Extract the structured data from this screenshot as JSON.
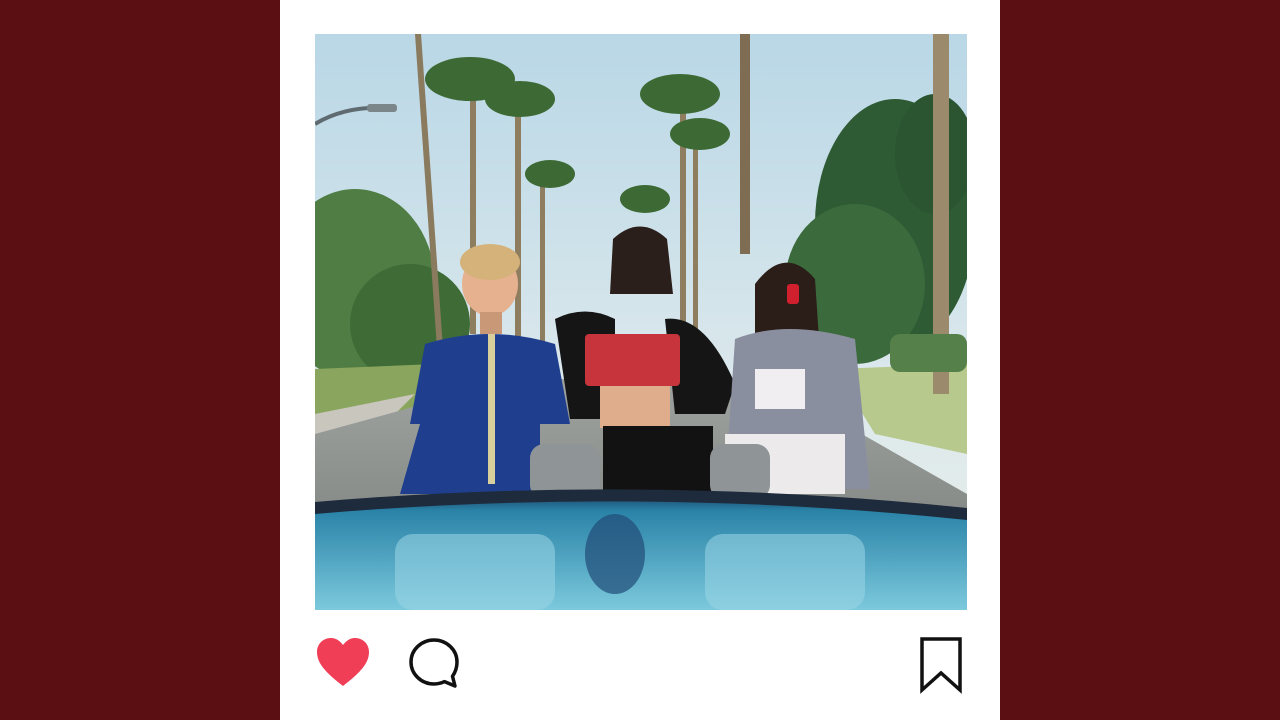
{
  "post": {
    "photo": {
      "subject": "three-people-seated-on-back-of-convertible"
    },
    "actions": {
      "like": {
        "icon": "heart-icon",
        "liked": true,
        "color": "#ef3e56"
      },
      "comment": {
        "icon": "comment-bubble-icon",
        "color": "#111111"
      },
      "save": {
        "icon": "bookmark-icon",
        "color": "#111111"
      }
    }
  },
  "colors": {
    "background": "#5c0f13",
    "card": "#ffffff"
  }
}
